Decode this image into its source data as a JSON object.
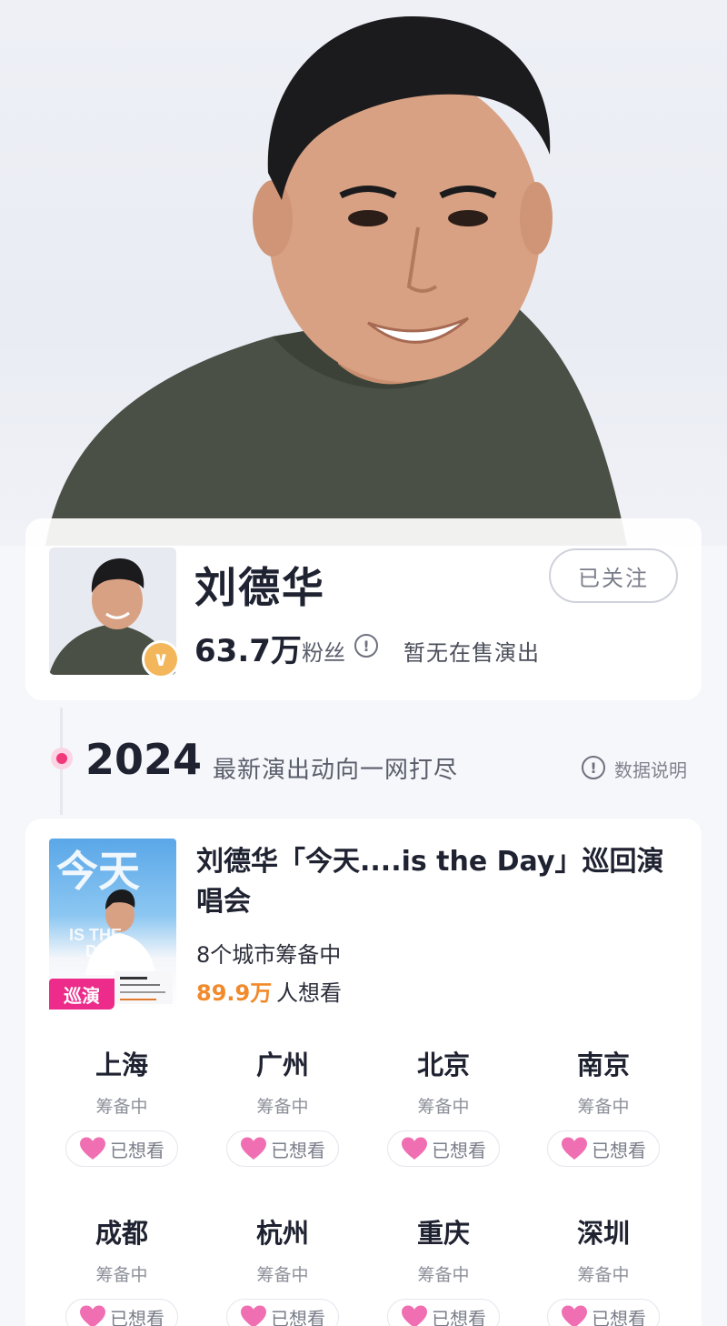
{
  "artist": {
    "name": "刘德华",
    "follow_label": "已关注",
    "fans_count": "63.7万",
    "fans_label": "粉丝",
    "info_glyph": "!",
    "verified_glyph": "∨",
    "no_shows": "暂无在售演出"
  },
  "timeline": {
    "year": "2024",
    "subtitle": "最新演出动向一网打尽",
    "data_note_label": "数据说明"
  },
  "tour": {
    "title": "刘德华「今天....is the Day」巡回演唱会",
    "badge": "巡演",
    "cities_summary": "8个城市筹备中",
    "want_count": "89.9万",
    "want_label": "人想看",
    "cities": [
      {
        "name": "上海",
        "status": "筹备中",
        "button": "已想看"
      },
      {
        "name": "广州",
        "status": "筹备中",
        "button": "已想看"
      },
      {
        "name": "北京",
        "status": "筹备中",
        "button": "已想看"
      },
      {
        "name": "南京",
        "status": "筹备中",
        "button": "已想看"
      },
      {
        "name": "成都",
        "status": "筹备中",
        "button": "已想看"
      },
      {
        "name": "杭州",
        "status": "筹备中",
        "button": "已想看"
      },
      {
        "name": "重庆",
        "status": "筹备中",
        "button": "已想看"
      },
      {
        "name": "深圳",
        "status": "筹备中",
        "button": "已想看"
      }
    ]
  },
  "colors": {
    "accent_pink": "#ec2b8a",
    "want_orange": "#f28a2c",
    "verified_gold": "#f3b65a"
  }
}
